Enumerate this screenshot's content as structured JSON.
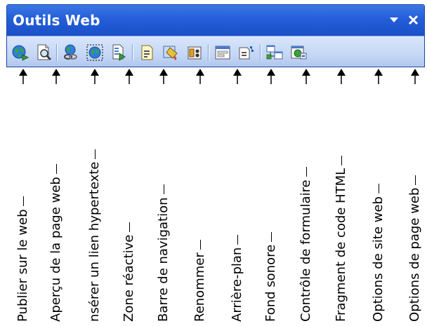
{
  "toolbar": {
    "title": "Outils Web",
    "buttons": [
      {
        "icon": "globe-publish-icon"
      },
      {
        "icon": "page-preview-icon"
      },
      {
        "icon": "hyperlink-icon"
      },
      {
        "icon": "hotspot-icon"
      },
      {
        "icon": "navigation-bar-icon"
      },
      {
        "icon": "rename-icon"
      },
      {
        "icon": "background-icon"
      },
      {
        "icon": "background-sound-icon"
      },
      {
        "icon": "form-control-icon"
      },
      {
        "icon": "html-fragment-icon"
      },
      {
        "icon": "web-site-options-icon"
      },
      {
        "icon": "web-page-options-icon"
      }
    ]
  },
  "callouts": [
    {
      "label": "Publier sur le web"
    },
    {
      "label": "Aperçu de la page web"
    },
    {
      "label": "nsérer un lien hypertexte"
    },
    {
      "label": "Zone réactive"
    },
    {
      "label": "Barre de navigation"
    },
    {
      "label": "Renommer"
    },
    {
      "label": "Arrière-plan"
    },
    {
      "label": "Fond sonore"
    },
    {
      "label": "Contrôle de formulaire"
    },
    {
      "label": "Fragment de code HTML"
    },
    {
      "label": "Options de site web"
    },
    {
      "label": "Options de page web"
    }
  ]
}
